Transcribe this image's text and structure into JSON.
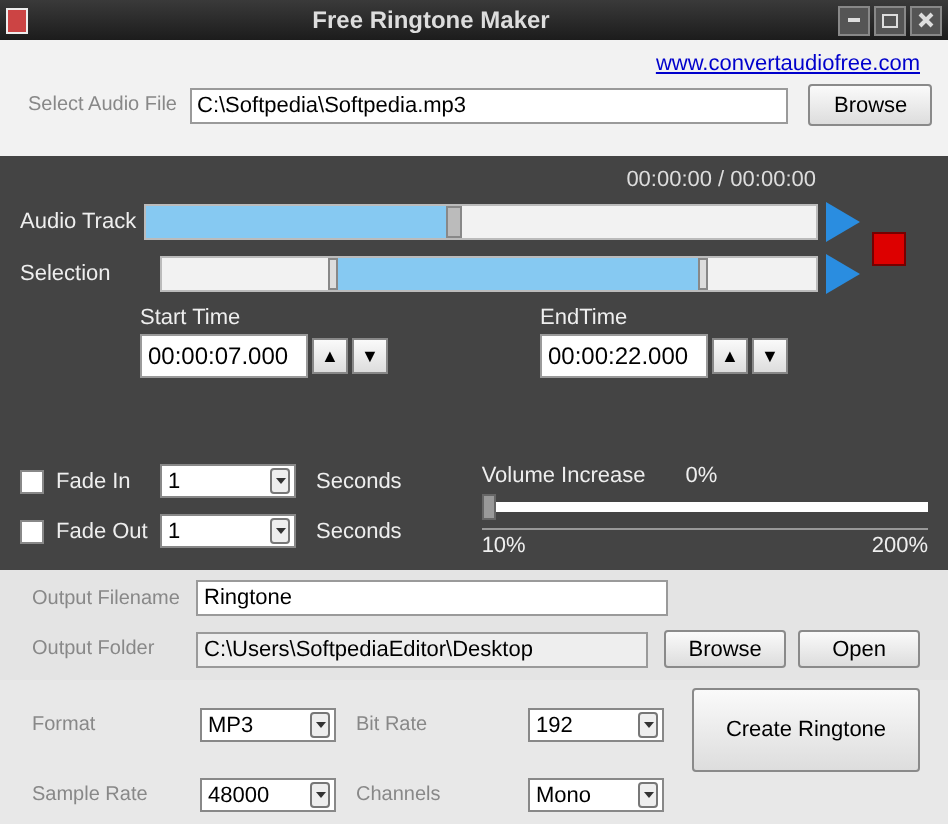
{
  "window": {
    "title": "Free Ringtone Maker"
  },
  "link": "www.convertaudiofree.com",
  "audio_file": {
    "label": "Select Audio File",
    "value": "C:\\Softpedia\\Softpedia.mp3",
    "button": "Browse"
  },
  "player": {
    "time": "00:00:00 / 00:00:00",
    "track": {
      "label": "Audio Track",
      "level": 0.46
    },
    "selection": {
      "label": "Selection",
      "start": {
        "level": 0.27
      },
      "end": {
        "level": 0.82
      }
    },
    "start_time": {
      "label": "Start Time",
      "value": "00:00:07.000",
      "up": "▲",
      "down": "▼"
    },
    "end_time": {
      "label": "EndTime",
      "value": "00:00:22.000",
      "up": "▲",
      "down": "▼"
    }
  },
  "fades": [
    {
      "label": "Fade In",
      "checked": false,
      "value": "1",
      "unit": "Seconds"
    },
    {
      "label": "Fade Out",
      "checked": false,
      "value": "1",
      "unit": "Seconds"
    }
  ],
  "volume": {
    "label": "Volume Increase",
    "reading": "0%",
    "level": 0,
    "min": "10%",
    "max": "200%"
  },
  "output": {
    "filename_label": "Output Filename",
    "filename": "Ringtone",
    "folder_label": "Output Folder",
    "folder": "C:\\Users\\SoftpediaEditor\\Desktop",
    "buttons": [
      "Browse",
      "Open"
    ]
  },
  "settings": [
    {
      "label": "Format",
      "value": "MP3"
    },
    {
      "label": "Bit Rate",
      "value": "192"
    },
    {
      "label": "Sample Rate",
      "value": "48000"
    },
    {
      "label": "Channels",
      "value": "Mono"
    }
  ],
  "create_button": "Create Ringtone"
}
